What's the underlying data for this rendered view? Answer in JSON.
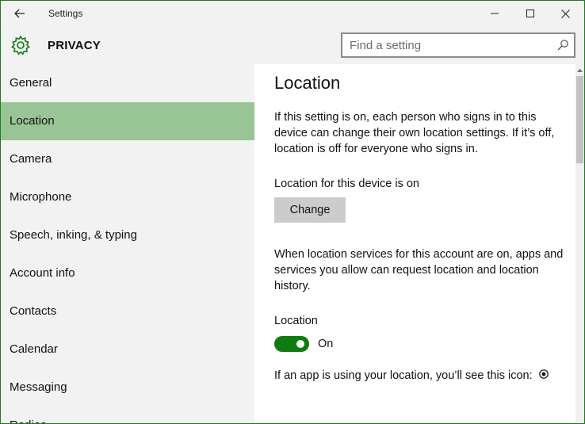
{
  "window": {
    "title": "Settings",
    "accent_color": "#107c10",
    "selected_color": "#99c596"
  },
  "header": {
    "section_title": "PRIVACY",
    "search_placeholder": "Find a setting"
  },
  "sidebar": {
    "items": [
      {
        "label": "General",
        "selected": false
      },
      {
        "label": "Location",
        "selected": true
      },
      {
        "label": "Camera",
        "selected": false
      },
      {
        "label": "Microphone",
        "selected": false
      },
      {
        "label": "Speech, inking, & typing",
        "selected": false
      },
      {
        "label": "Account info",
        "selected": false
      },
      {
        "label": "Contacts",
        "selected": false
      },
      {
        "label": "Calendar",
        "selected": false
      },
      {
        "label": "Messaging",
        "selected": false
      },
      {
        "label": "Radios",
        "selected": false
      }
    ]
  },
  "content": {
    "page_title": "Location",
    "description": "If this setting is on, each person who signs in to this device can change their own location settings. If it’s off, location is off for everyone who signs in.",
    "device_status": "Location for this device is on",
    "change_button": "Change",
    "services_description": "When location services for this account are on, apps and services you allow can request location and location history.",
    "toggle_label": "Location",
    "toggle_state": "On",
    "icon_note": "If an app is using your location, you’ll see this icon:"
  }
}
